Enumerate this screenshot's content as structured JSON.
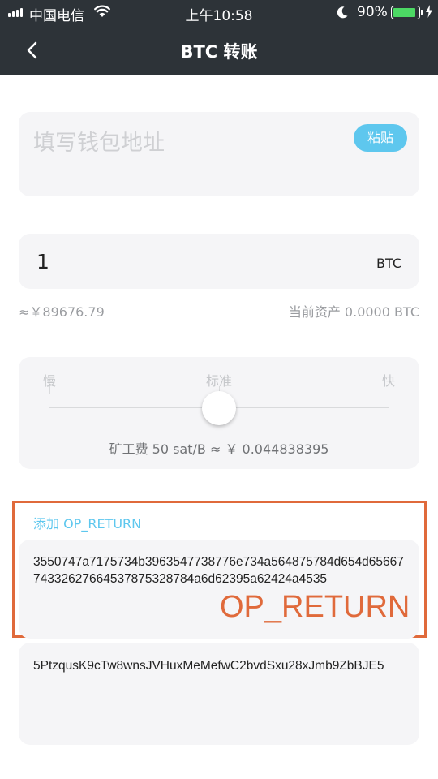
{
  "status_bar": {
    "carrier": "中国电信",
    "time": "上午10:58",
    "battery_percent": "90%",
    "battery_level": 0.9,
    "icons": [
      "signal-icon",
      "wifi-icon",
      "moon-icon",
      "battery-icon",
      "charging-icon"
    ]
  },
  "nav": {
    "title": "BTC 转账",
    "back_icon": "chevron-left-icon"
  },
  "address": {
    "placeholder": "填写钱包地址",
    "paste_label": "粘贴"
  },
  "amount": {
    "value": "1",
    "unit": "BTC",
    "approx": "≈￥89676.79",
    "balance": "当前资产 0.0000 BTC"
  },
  "fee": {
    "slow_label": "慢",
    "standard_label": "标准",
    "fast_label": "快",
    "slider_level": 0.5,
    "fee_text": "矿工费 50 sat/B ≈ ￥ 0.044838395"
  },
  "op_return": {
    "add_label": "添加 OP_RETURN",
    "data": "3550747a7175734b3963547738776e734a564875784d654d6566774332627664537875328784a6d62395a62424a4535",
    "annotation": "OP_RETURN"
  },
  "memo": {
    "text": "5PtzqusK9cTw8wnsJVHuxMeMefwC2bvdSxu28xJmb9ZbBJE5"
  },
  "colors": {
    "header_bg": "#2d3338",
    "accent": "#5ec7ee",
    "annotation": "#e06a3b",
    "card_bg": "#f5f5f7",
    "battery_green": "#4cd964"
  }
}
